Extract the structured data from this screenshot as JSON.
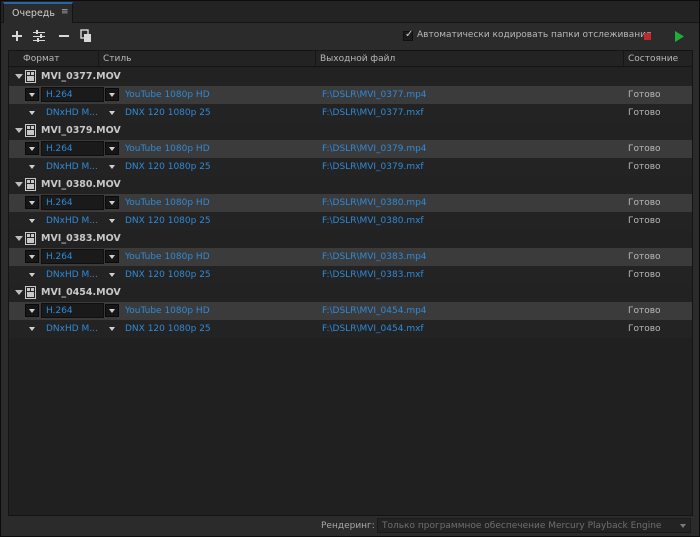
{
  "tab": {
    "label": "Очередь"
  },
  "toolbar": {
    "add_icon": "plus-icon",
    "settings_icon": "sliders-icon",
    "remove_icon": "minus-icon",
    "duplicate_icon": "duplicate-icon",
    "auto_encode_checked": true,
    "auto_encode_label": "Автоматически кодировать папки отслеживания",
    "stop_color": "#c02a2a",
    "play_color": "#1fae3a"
  },
  "columns": [
    "Формат",
    "Стиль",
    "Выходной файл",
    "Состояние"
  ],
  "groups": [
    {
      "name": "MVI_0377.MOV",
      "outputs": [
        {
          "format": "H.264",
          "preset": "YouTube 1080p HD",
          "file": "F:\\DSLR\\MVI_0377.mp4",
          "status": "Готово"
        },
        {
          "format": "DNxHD M...",
          "preset": "DNX 120 1080p 25",
          "file": "F:\\DSLR\\MVI_0377.mxf",
          "status": "Готово"
        }
      ]
    },
    {
      "name": "MVI_0379.MOV",
      "outputs": [
        {
          "format": "H.264",
          "preset": "YouTube 1080p HD",
          "file": "F:\\DSLR\\MVI_0379.mp4",
          "status": "Готово"
        },
        {
          "format": "DNxHD M...",
          "preset": "DNX 120 1080p 25",
          "file": "F:\\DSLR\\MVI_0379.mxf",
          "status": "Готово"
        }
      ]
    },
    {
      "name": "MVI_0380.MOV",
      "outputs": [
        {
          "format": "H.264",
          "preset": "YouTube 1080p HD",
          "file": "F:\\DSLR\\MVI_0380.mp4",
          "status": "Готово"
        },
        {
          "format": "DNxHD M...",
          "preset": "DNX 120 1080p 25",
          "file": "F:\\DSLR\\MVI_0380.mxf",
          "status": "Готово"
        }
      ]
    },
    {
      "name": "MVI_0383.MOV",
      "outputs": [
        {
          "format": "H.264",
          "preset": "YouTube 1080p HD",
          "file": "F:\\DSLR\\MVI_0383.mp4",
          "status": "Готово"
        },
        {
          "format": "DNxHD M...",
          "preset": "DNX 120 1080p 25",
          "file": "F:\\DSLR\\MVI_0383.mxf",
          "status": "Готово"
        }
      ]
    },
    {
      "name": "MVI_0454.MOV",
      "outputs": [
        {
          "format": "H.264",
          "preset": "YouTube 1080p HD",
          "file": "F:\\DSLR\\MVI_0454.mp4",
          "status": "Готово"
        },
        {
          "format": "DNxHD M...",
          "preset": "DNX 120 1080p 25",
          "file": "F:\\DSLR\\MVI_0454.mxf",
          "status": "Готово"
        }
      ]
    }
  ],
  "footer": {
    "render_label": "Рендеринг:",
    "render_value": "Только программное обеспечение Mercury Playback Engine"
  },
  "colors": {
    "link": "#2f8ad8",
    "tab_accent": "#2a64a8",
    "selected_row": "#3b3b3b"
  }
}
